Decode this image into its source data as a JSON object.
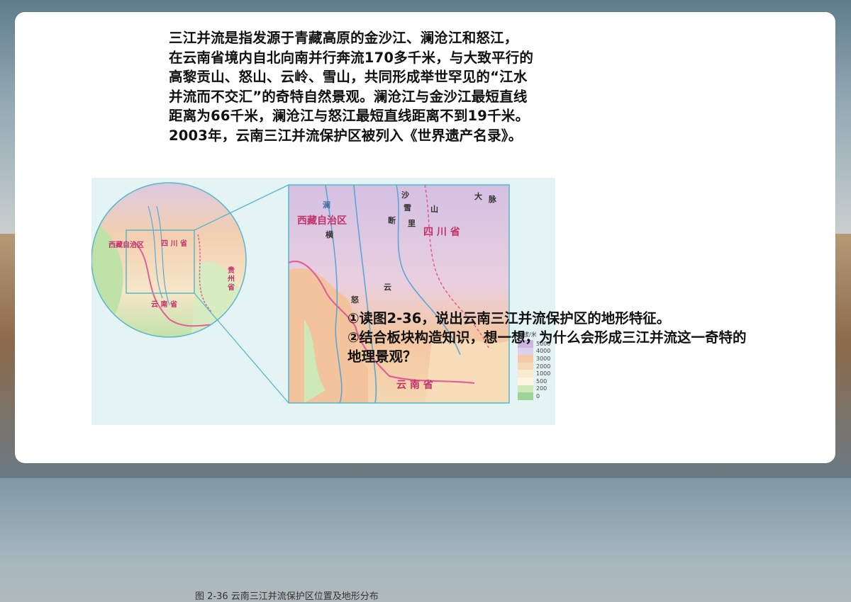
{
  "intro_text": "三江并流是指发源于青藏高原的金沙江、澜沧江和怒江，\n在云南省境内自北向南并行奔流170多千米，与大致平行的\n高黎贡山、怒山、云岭、雪山，共同形成举世罕见的“江水\n并流而不交汇”的奇特自然景观。澜沧江与金沙江最短直线\n距离为66千米，澜沧江与怒江最短直线距离不到19千米。\n2003年，云南三江并流保护区被列入《世界遗产名录》。",
  "figure": {
    "caption": "图 2-36   云南三江并流保护区位置及地形分布",
    "circle_labels": {
      "xizang": "西藏自治区",
      "sichuan": "四  川  省",
      "yunnan": "云  南  省",
      "guizhou": "贵\n州\n省"
    },
    "detail_labels": {
      "xizang": "西藏自治区",
      "sichuan": "四  川  省",
      "yunnan": "云     南     省",
      "lancang": "澜",
      "nu": "怒",
      "heng": "横",
      "sha": "沙",
      "xue": "雪",
      "shan": "山",
      "da": "大",
      "mai": "脉",
      "yun": "云",
      "duan": "断",
      "li": "里"
    },
    "legend_title": "海拔/米",
    "legend": [
      {
        "value": "5000",
        "color": "#cbb6df"
      },
      {
        "value": "4000",
        "color": "#ddd0ea"
      },
      {
        "value": "3000",
        "color": "#f4c9a8"
      },
      {
        "value": "2000",
        "color": "#f5d9b6"
      },
      {
        "value": "1000",
        "color": "#f7ecd0"
      },
      {
        "value": "500",
        "color": "#fbf5e2"
      },
      {
        "value": "200",
        "color": "#cfe8b8"
      },
      {
        "value": "0",
        "color": "#9fd39a"
      }
    ]
  },
  "questions": [
    "①读图2-36，说出云南三江并流保护区的地形特征。",
    "②结合板块构造知识，想一想，为什么会形成三江并流这一奇特的地理景观？"
  ]
}
